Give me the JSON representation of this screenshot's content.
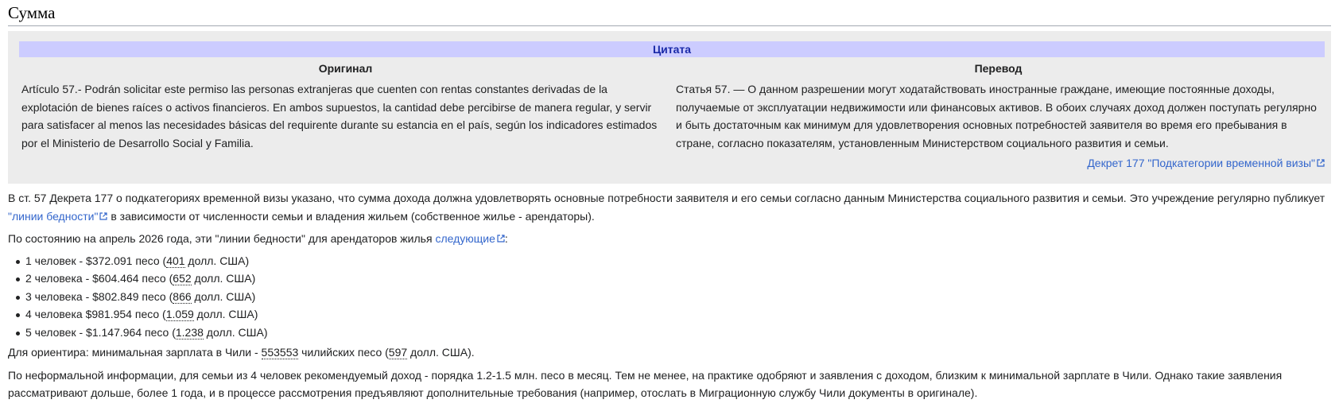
{
  "section": {
    "title": "Сумма"
  },
  "quote": {
    "header": "Цитата",
    "original_title": "Оригинал",
    "translation_title": "Перевод",
    "original_text": "Artículo 57.- Podrán solicitar este permiso las personas extranjeras que cuenten con rentas constantes derivadas de la explotación de bienes raíces o activos financieros. En ambos supuestos, la cantidad debe percibirse de manera regular, y servir para satisfacer al menos las necesidades básicas del requirente durante su estancia en el país, según los indicadores estimados por el Ministerio de Desarrollo Social y Familia.",
    "translation_text": "Статья 57. — О данном разрешении могут ходатайствовать иностранные граждане, имеющие постоянные доходы, получаемые от эксплуатации недвижимости или финансовых активов. В обоих случаях доход должен поступать регулярно и быть достаточным как минимум для удовлетворения основных потребностей заявителя во время его пребывания в стране, согласно показателям, установленным Министерством социального развития и семьи.",
    "source_link": "Декрет 177 \"Подкатегории временной визы\""
  },
  "para1": {
    "text_before": "В ст. 57 Декрета 177 о подкатегориях временной визы указано, что сумма дохода должна удовлетворять основные потребности заявителя и его семьи согласно данным Министерства социального развития и семьи. Это учреждение регулярно публикует ",
    "link": "\"линии бедности\"",
    "text_after": " в зависимости от численности семьи и владения жильем (собственное жилье - арендаторы)."
  },
  "para2": {
    "text_before": "По состоянию на апрель 2026 года, эти \"линии бедности\" для арендаторов жилья ",
    "link": "следующие",
    "text_after": ":"
  },
  "list": [
    {
      "prefix": "1 человек - $372.091 песо (",
      "usd": "401",
      "suffix": " долл. США)"
    },
    {
      "prefix": "2 человека - $604.464 песо (",
      "usd": "652",
      "suffix": " долл. США)"
    },
    {
      "prefix": "3 человека - $802.849 песо (",
      "usd": "866",
      "suffix": " долл. США)"
    },
    {
      "prefix": "4 человека $981.954 песо (",
      "usd": "1.059",
      "suffix": " долл. США)"
    },
    {
      "prefix": "5 человек - $1.147.964 песо (",
      "usd": "1.238",
      "suffix": " долл. США)"
    }
  ],
  "para3": {
    "text_before": "Для ориентира: минимальная зарплата в Чили - ",
    "clp": "553553",
    "text_mid": " чилийских песо (",
    "usd": "597",
    "text_after": " долл. США)."
  },
  "para4": {
    "text": "По неформальной информации, для семьи из 4 человек рекомендуемый доход - порядка 1.2-1.5 млн. песо в месяц. Тем не менее, на практике одобряют и заявления с доходом, близким к минимальной зарплате в Чили. Однако такие заявления рассматривают дольше, более 1 года, и в процессе рассмотрения предъявляют дополнительные требования (например, отослать в Миграционную службу Чили документы в оригинале)."
  },
  "colors": {
    "link": "#3366cc",
    "quote_header_bg": "#ccccff",
    "quote_box_bg": "#ececec",
    "text": "#202122"
  },
  "icons": {
    "external_link": "external-link-icon"
  }
}
